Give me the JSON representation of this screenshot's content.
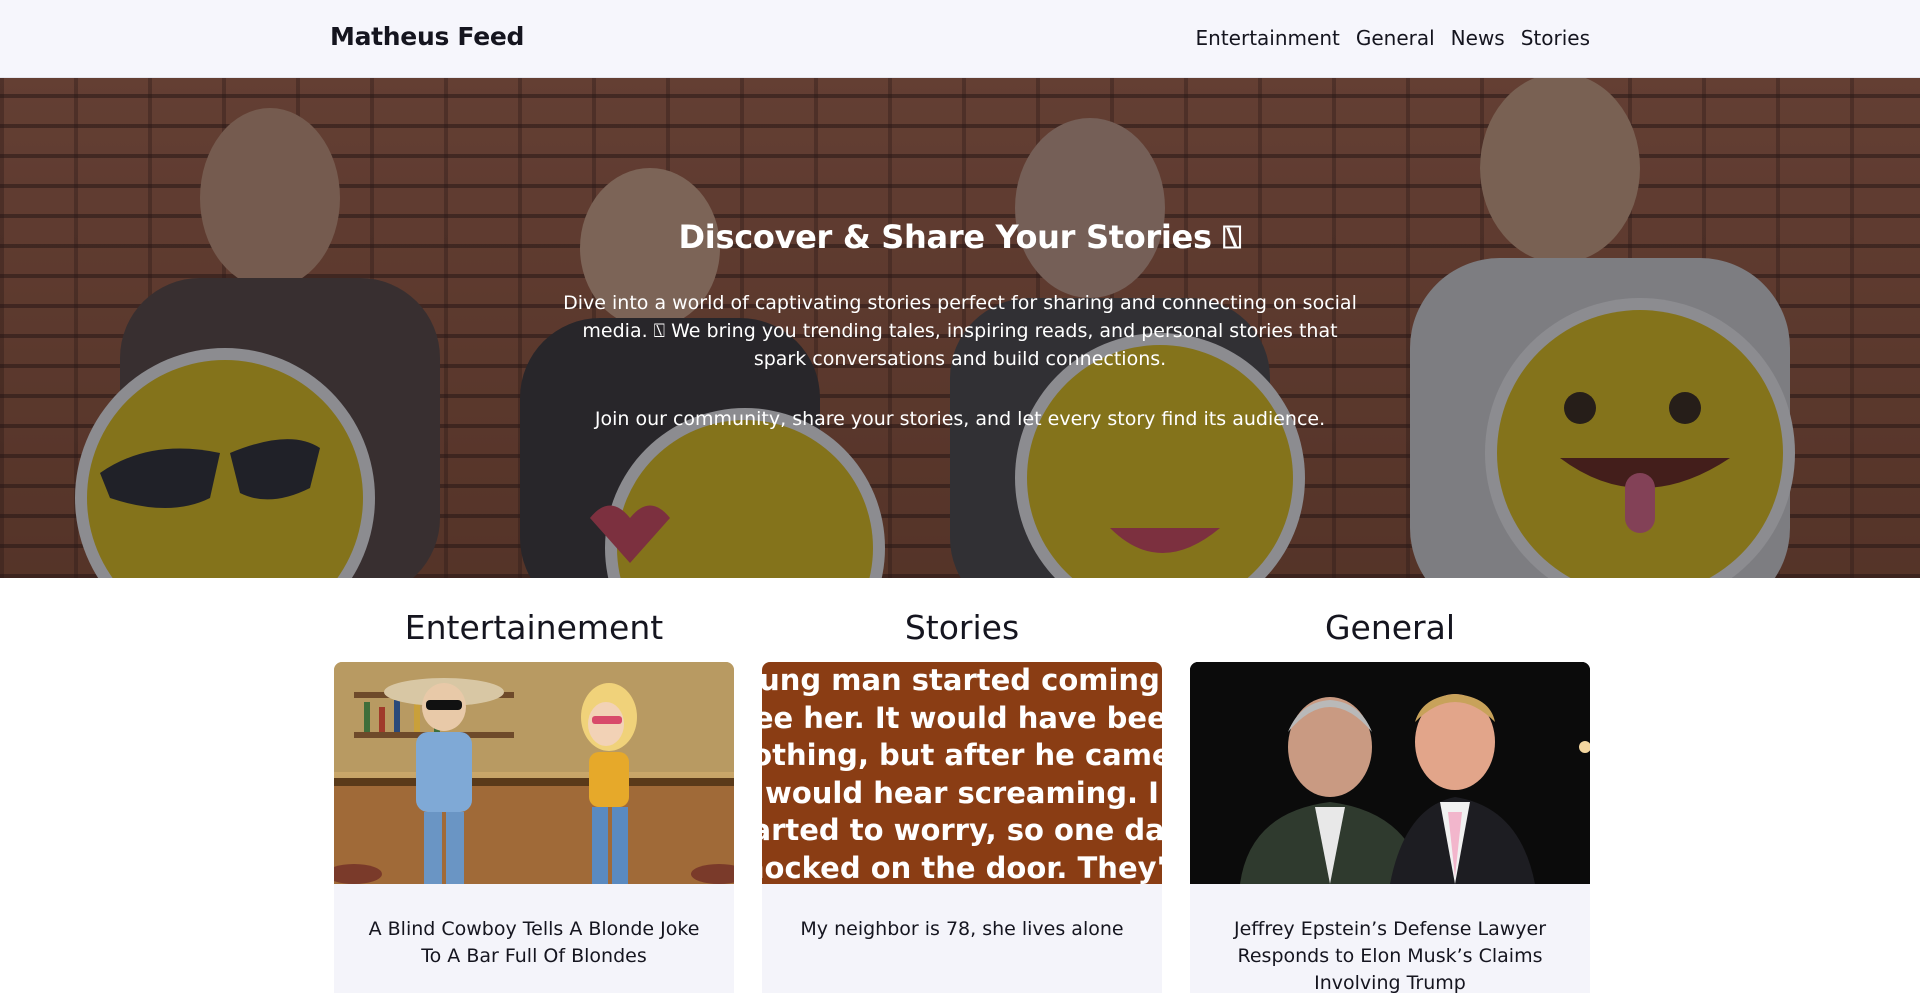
{
  "header": {
    "brand": "Matheus Feed",
    "nav": [
      "Entertainment",
      "General",
      "News",
      "Stories"
    ]
  },
  "hero": {
    "title": "Discover & Share Your Stories ⍂",
    "description": "Dive into a world of captivating stories perfect for sharing and connecting on social media. ⍂ We bring you trending tales, inspiring reads, and personal stories that spark conversations and build connections.",
    "join": "Join our community, share your stories, and let every story find its audience."
  },
  "categories": [
    {
      "heading": "Entertainement",
      "article_title": "A Blind Cowboy Tells A Blonde Joke To A Bar Full Of Blondes",
      "image": "cartoon-cowboy-bar-image"
    },
    {
      "heading": "Stories",
      "article_title": "My neighbor is 78, she lives alone",
      "image_text": [
        "young man started coming to",
        "see her. It would have been",
        "nothing, but after he came I",
        "would hear screaming. I",
        "started to worry, so one day I",
        "knocked on the door. They're"
      ],
      "image": "story-text-image"
    },
    {
      "heading": "General",
      "article_title": "Jeffrey Epstein’s Defense Lawyer Responds to Elon Musk’s Claims Involving Trump",
      "image": "two-men-photo-image"
    }
  ],
  "colors": {
    "header_bg": "#f6f6fc",
    "card_bg": "#f4f4fa",
    "story_thumb_bg": "#8a3d14",
    "text_dark": "#15151f"
  }
}
